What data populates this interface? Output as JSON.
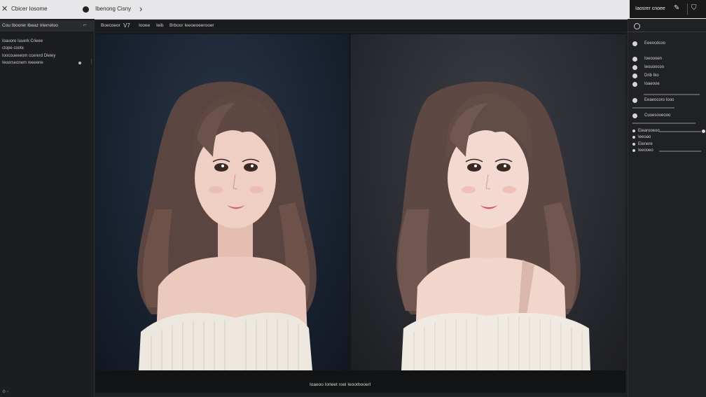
{
  "topbar": {
    "title": "Cbicer Iosome",
    "subtitle": "Ibenong Cisny",
    "right_label": "Iaosrer cnoee"
  },
  "left_panel": {
    "header": "Cou Iboorer Ibeaz Irierretoo",
    "lines": [
      "Ioauore Iuuerk Crieee",
      "ctope coote",
      "Ioocoueeeom ccererd Dieiey",
      "Ieoerseonem reeeene"
    ]
  },
  "toolbar": {
    "items": [
      "Boecoeor",
      "V7",
      "Iooee",
      "Ieib",
      "Brboor Ieeoeoeerooer"
    ]
  },
  "status": {
    "label": "Ioaeoo Iorleet roel Ieoorbooerl"
  },
  "right_panel": {
    "items": [
      "Eeeocdcoo",
      "Ioeoooen",
      "Ieouoocoo",
      "Drib Iko",
      "Ioaeooe"
    ],
    "section_label": "Eeaeocoro Iooo",
    "section_sub": "Cuoesooeooo",
    "sliders": [
      "Eiearooeoo",
      "Ieeoao",
      "Eienere",
      "Ieeooeo"
    ]
  },
  "colors": {
    "panel_bg": "#1c1d1f",
    "topbar_bg": "#e7e7e9",
    "canvas_bg": "#17181a",
    "accent": "#dcdcdc"
  }
}
